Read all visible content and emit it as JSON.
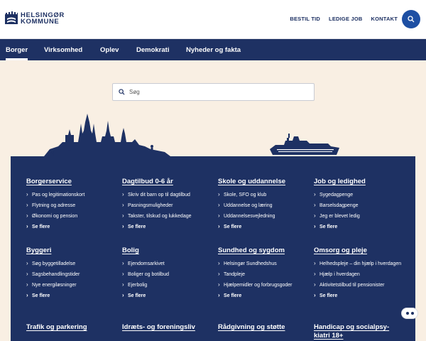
{
  "brand": {
    "line1": "HELSINGØR",
    "line2": "KOMMUNE"
  },
  "toplinks": [
    "BESTIL TID",
    "LEDIGE JOB",
    "KONTAKT"
  ],
  "nav": [
    "Borger",
    "Virksomhed",
    "Oplev",
    "Demokrati",
    "Nyheder og fakta"
  ],
  "search": {
    "placeholder": "Søg"
  },
  "columns": [
    {
      "title": "Borgerservice",
      "items": [
        "Pas og legitimationskort",
        "Flytning og adresse",
        "Økonomi og pension",
        "Se flere"
      ]
    },
    {
      "title": "Dagtilbud 0-6 år",
      "items": [
        "Skriv dit barn op til dagtilbud",
        "Pasningsmuligheder",
        "Takster, tilskud og lukkedage",
        "Se flere"
      ]
    },
    {
      "title": "Skole og uddannelse",
      "items": [
        "Skole, SFO og klub",
        "Uddannelse og læring",
        "Uddannelsesvejledning",
        "Se flere"
      ]
    },
    {
      "title": "Job og ledighed",
      "items": [
        "Sygedagpenge",
        "Barselsdagpenge",
        "Jeg er blevet ledig",
        "Se flere"
      ]
    },
    {
      "title": "Byggeri",
      "items": [
        "Søg byggetilladelse",
        "Sagsbehandlingstider",
        "Nye energiløsninger",
        "Se flere"
      ]
    },
    {
      "title": "Bolig",
      "items": [
        "Ejendomsarkivet",
        "Boliger og botilbud",
        "Ejerbolig",
        "Se flere"
      ]
    },
    {
      "title": "Sundhed og sygdom",
      "items": [
        "Helsingør Sundhedshus",
        "Tandpleje",
        "Hjælpemidler og forbrugsgoder",
        "Se flere"
      ]
    },
    {
      "title": "Omsorg og pleje",
      "items": [
        "Helhedspleje – din hjælp i hverdagen",
        "Hjælp i hverdagen",
        "Aktivitetstilbud til pensionister",
        "Se flere"
      ]
    },
    {
      "title": "Trafik og parkering",
      "items": []
    },
    {
      "title": "Idræts- og foreningsliv",
      "items": []
    },
    {
      "title": "Rådgivning og støtte",
      "items": []
    },
    {
      "title": "Handicap og socialpsy-kiatri 18+",
      "items": []
    }
  ],
  "colors": {
    "navy": "#1e3163",
    "accent": "#1d4fa3",
    "hero": "#f9efe3"
  }
}
